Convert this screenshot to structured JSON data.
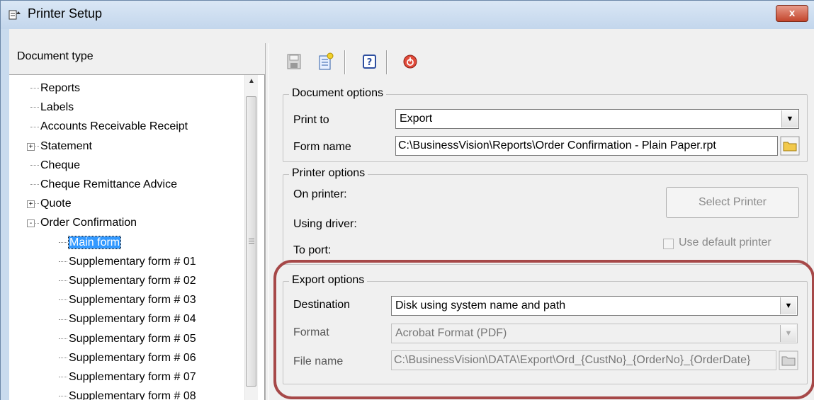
{
  "window": {
    "title": "Printer Setup",
    "close_glyph": "x"
  },
  "left": {
    "header": "Document type",
    "tree": [
      {
        "label": "Reports",
        "expander": ""
      },
      {
        "label": "Labels",
        "expander": ""
      },
      {
        "label": "Accounts Receivable Receipt",
        "expander": ""
      },
      {
        "label": "Statement",
        "expander": "+"
      },
      {
        "label": "Cheque",
        "expander": ""
      },
      {
        "label": "Cheque Remittance Advice",
        "expander": ""
      },
      {
        "label": "Quote",
        "expander": "+"
      },
      {
        "label": "Order Confirmation",
        "expander": "-"
      },
      {
        "label": "Main form",
        "expander": "",
        "selected": true
      },
      {
        "label": "Supplementary form # 01",
        "expander": ""
      },
      {
        "label": "Supplementary form # 02",
        "expander": ""
      },
      {
        "label": "Supplementary form # 03",
        "expander": ""
      },
      {
        "label": "Supplementary form # 04",
        "expander": ""
      },
      {
        "label": "Supplementary form # 05",
        "expander": ""
      },
      {
        "label": "Supplementary form # 06",
        "expander": ""
      },
      {
        "label": "Supplementary form # 07",
        "expander": ""
      },
      {
        "label": "Supplementary form # 08",
        "expander": ""
      }
    ]
  },
  "toolbar": {
    "buttons": [
      "save-icon",
      "new-form-icon",
      "help-icon",
      "power-icon"
    ]
  },
  "document_options": {
    "title": "Document options",
    "print_to_label": "Print to",
    "print_to_value": "Export",
    "form_name_label": "Form name",
    "form_name_value": "C:\\BusinessVision\\Reports\\Order Confirmation - Plain Paper.rpt"
  },
  "printer_options": {
    "title": "Printer options",
    "on_printer_label": "On printer:",
    "using_driver_label": "Using driver:",
    "to_port_label": "To port:",
    "select_printer_label": "Select Printer",
    "use_default_label": "Use default printer",
    "use_default_checked": false
  },
  "export_options": {
    "title": "Export options",
    "destination_label": "Destination",
    "destination_value": "Disk using system name and path",
    "format_label": "Format",
    "format_value": "Acrobat Format (PDF)",
    "file_name_label": "File name",
    "file_name_value": "C:\\BusinessVision\\DATA\\Export\\Ord_{CustNo}_{OrderNo}_{OrderDate}"
  },
  "colors": {
    "highlight": "#a64848",
    "selection": "#3399ff",
    "titlebar": "#c3d6ec"
  }
}
